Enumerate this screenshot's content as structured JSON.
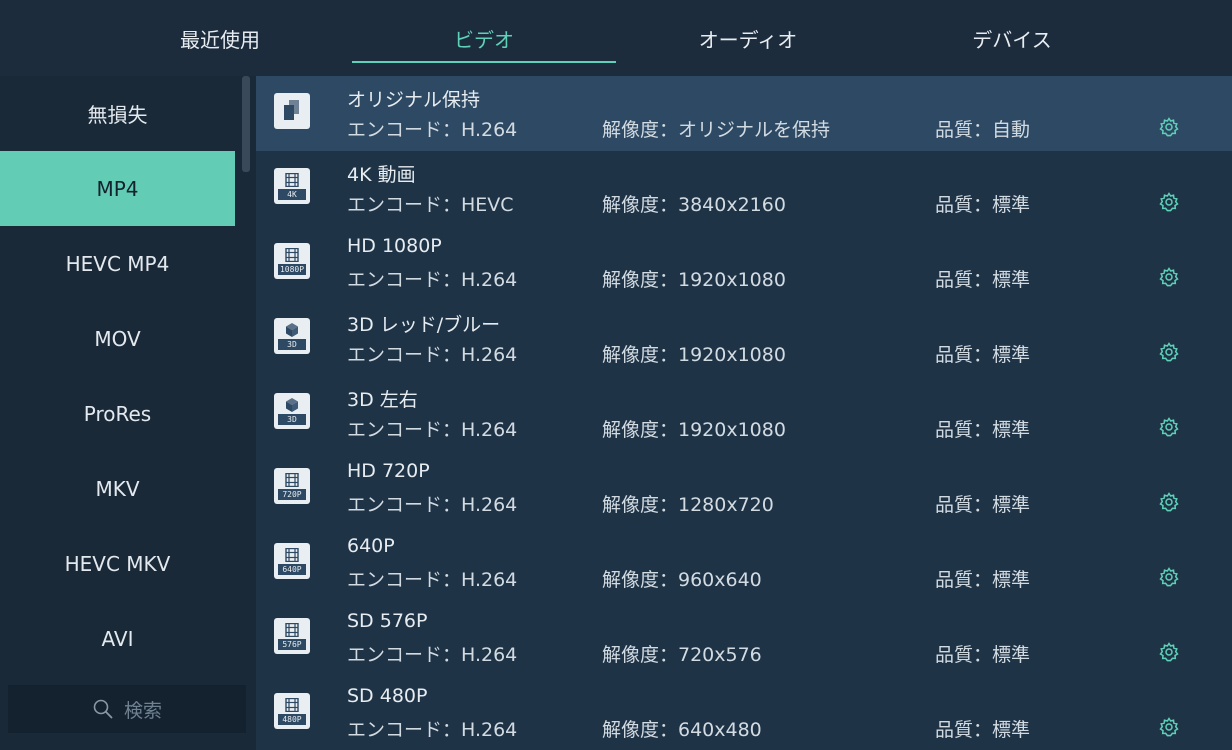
{
  "tabs": [
    {
      "label": "最近使用"
    },
    {
      "label": "ビデオ"
    },
    {
      "label": "オーディオ"
    },
    {
      "label": "デバイス"
    }
  ],
  "active_tab": "ビデオ",
  "accent_color": "#5fd1b8",
  "sidebar": {
    "items": [
      {
        "label": "無損失"
      },
      {
        "label": "MP4"
      },
      {
        "label": "HEVC MP4"
      },
      {
        "label": "MOV"
      },
      {
        "label": "ProRes"
      },
      {
        "label": "MKV"
      },
      {
        "label": "HEVC MKV"
      },
      {
        "label": "AVI"
      }
    ],
    "selected": "MP4",
    "search_placeholder": "検索"
  },
  "formats": [
    {
      "name": "オリジナル保持",
      "icon": "copy-icon",
      "badge": "",
      "encode": "エンコード：H.264",
      "resolution": "解像度：オリジナルを保持",
      "quality": "品質：自動"
    },
    {
      "name": "4K 動画",
      "icon": "film-icon",
      "badge": "4K",
      "encode": "エンコード：HEVC",
      "resolution": "解像度：3840x2160",
      "quality": "品質：標準"
    },
    {
      "name": "HD 1080P",
      "icon": "film-icon",
      "badge": "1080P",
      "encode": "エンコード：H.264",
      "resolution": "解像度：1920x1080",
      "quality": "品質：標準"
    },
    {
      "name": "3D レッド/ブルー",
      "icon": "cube-icon",
      "badge": "3D",
      "encode": "エンコード：H.264",
      "resolution": "解像度：1920x1080",
      "quality": "品質：標準"
    },
    {
      "name": "3D 左右",
      "icon": "cube-icon",
      "badge": "3D",
      "encode": "エンコード：H.264",
      "resolution": "解像度：1920x1080",
      "quality": "品質：標準"
    },
    {
      "name": "HD 720P",
      "icon": "film-icon",
      "badge": "720P",
      "encode": "エンコード：H.264",
      "resolution": "解像度：1280x720",
      "quality": "品質：標準"
    },
    {
      "name": "640P",
      "icon": "film-icon",
      "badge": "640P",
      "encode": "エンコード：H.264",
      "resolution": "解像度：960x640",
      "quality": "品質：標準"
    },
    {
      "name": "SD 576P",
      "icon": "film-icon",
      "badge": "576P",
      "encode": "エンコード：H.264",
      "resolution": "解像度：720x576",
      "quality": "品質：標準"
    },
    {
      "name": "SD 480P",
      "icon": "film-icon",
      "badge": "480P",
      "encode": "エンコード：H.264",
      "resolution": "解像度：640x480",
      "quality": "品質：標準"
    }
  ],
  "selected_format": "オリジナル保持"
}
